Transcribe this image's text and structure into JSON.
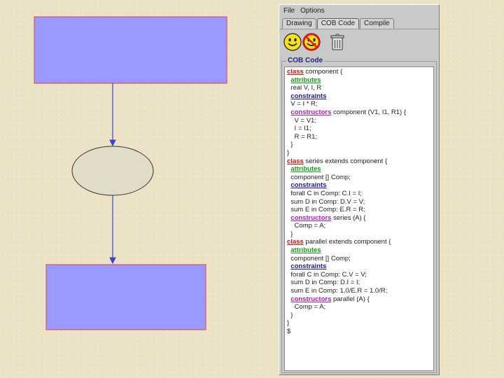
{
  "colors": {
    "box_fill": "#9999ff",
    "box_stroke": "#dd4444",
    "ellipse_fill": "#e0dcc8",
    "arrow": "#3a44c8",
    "kw_class": "#cc1111",
    "kw_attributes": "#1a9a1a",
    "kw_constraints": "#1a1aaa",
    "kw_constructors": "#b01cb0"
  },
  "menu": {
    "file": "File",
    "options": "Options"
  },
  "tabs": [
    {
      "label": "Drawing",
      "active": false
    },
    {
      "label": "COB Code",
      "active": true
    },
    {
      "label": "Compile",
      "active": false
    }
  ],
  "toolbar_icons": [
    "smiley-face-icon",
    "no-smiley-icon",
    "trash-can-icon"
  ],
  "panel": {
    "title": "COB Code"
  },
  "code_lines": [
    [
      {
        "kw": "class",
        "t": "class"
      },
      {
        "t": " component {"
      }
    ],
    [
      {
        "t": "  "
      },
      {
        "kw": "attributes",
        "t": "attributes"
      }
    ],
    [
      {
        "t": "  real V, I, R"
      }
    ],
    [
      {
        "t": "  "
      },
      {
        "kw": "constraints",
        "t": "constraints"
      }
    ],
    [
      {
        "t": "  V = I * R;"
      }
    ],
    [
      {
        "t": "  "
      },
      {
        "kw": "constructors",
        "t": "constructors"
      },
      {
        "t": " component (V1, I1, R1) {"
      }
    ],
    [
      {
        "t": "    V = V1;"
      }
    ],
    [
      {
        "t": "    I = I1;"
      }
    ],
    [
      {
        "t": "    R = R1;"
      }
    ],
    [
      {
        "t": "  }"
      }
    ],
    [
      {
        "t": "}"
      }
    ],
    [
      {
        "kw": "class",
        "t": "class"
      },
      {
        "t": " series extends component {"
      }
    ],
    [
      {
        "t": "  "
      },
      {
        "kw": "attributes",
        "t": "attributes"
      }
    ],
    [
      {
        "t": "  component [] Comp;"
      }
    ],
    [
      {
        "t": "  "
      },
      {
        "kw": "constraints",
        "t": "constraints"
      }
    ],
    [
      {
        "t": "  forall C in Comp: C.I = I;"
      }
    ],
    [
      {
        "t": "  sum D in Comp: D.V = V;"
      }
    ],
    [
      {
        "t": "  sum E in Comp: E.R = R;"
      }
    ],
    [
      {
        "t": "  "
      },
      {
        "kw": "constructors",
        "t": "constructors"
      },
      {
        "t": " series (A) {"
      }
    ],
    [
      {
        "t": "    Comp = A;"
      }
    ],
    [
      {
        "t": "  }"
      }
    ],
    [
      {
        "kw": "class",
        "t": "class"
      },
      {
        "t": " parallel extends component {"
      }
    ],
    [
      {
        "t": "  "
      },
      {
        "kw": "attributes",
        "t": "attributes"
      }
    ],
    [
      {
        "t": "  component [] Comp;"
      }
    ],
    [
      {
        "t": "  "
      },
      {
        "kw": "constraints",
        "t": "constraints"
      }
    ],
    [
      {
        "t": "  forall C in Comp: C.V = V;"
      }
    ],
    [
      {
        "t": "  sum D in Comp: D.I = I;"
      }
    ],
    [
      {
        "t": "  sum E in Comp: 1.0/E.R = 1.0/R;"
      }
    ],
    [
      {
        "t": "  "
      },
      {
        "kw": "constructors",
        "t": "constructors"
      },
      {
        "t": " parallel (A) {"
      }
    ],
    [
      {
        "t": "    Comp = A;"
      }
    ],
    [
      {
        "t": "  }"
      }
    ],
    [
      {
        "t": "}"
      }
    ],
    [
      {
        "t": "$"
      }
    ]
  ]
}
